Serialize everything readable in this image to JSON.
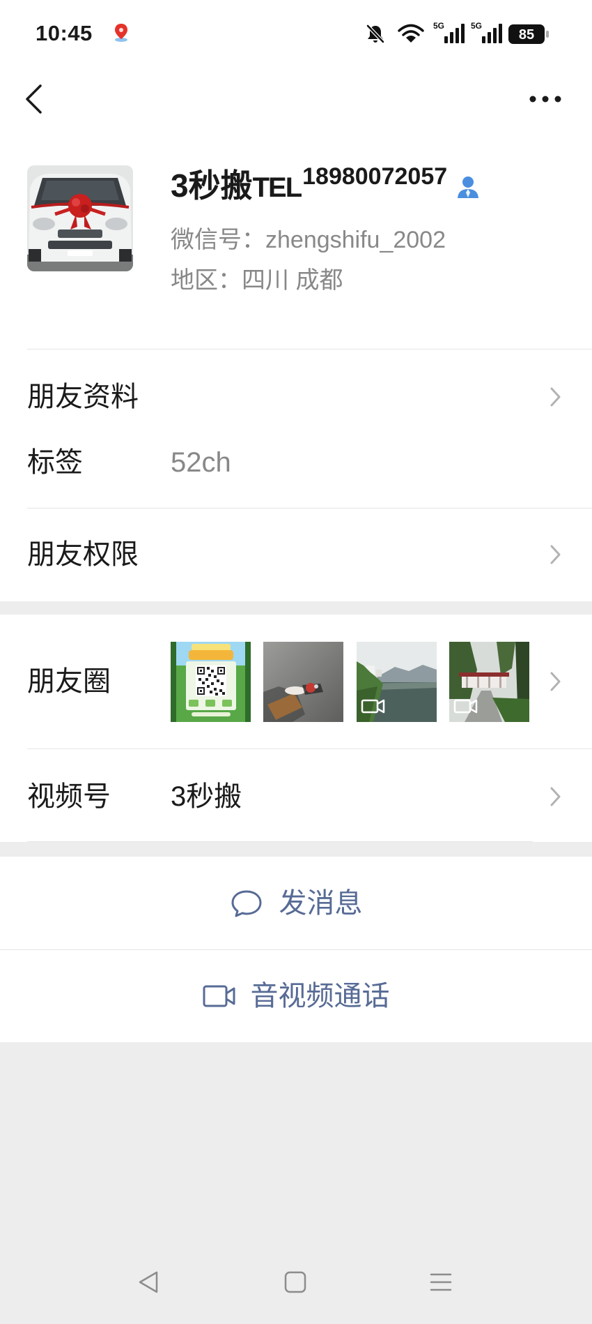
{
  "status_bar": {
    "time": "10:45",
    "network_1": "5G",
    "network_2": "5G",
    "battery": "85",
    "icons": [
      "location-pin-icon",
      "mute-bell-icon",
      "wifi-icon",
      "signal-icon",
      "signal-icon",
      "battery-icon"
    ]
  },
  "header": {
    "back_icon": "back-arrow-icon",
    "more_icon": "more-icon"
  },
  "profile": {
    "name": "3秒搬",
    "name_suffix": "TEL",
    "name_superscript": "18980072057",
    "wechat_id": "微信号：zhengshifu_2002",
    "region": "地区：四川 成都",
    "badge_icon": "contact-person-icon"
  },
  "rows": {
    "friend_profile": {
      "label": "朋友资料"
    },
    "tags": {
      "label": "标签",
      "value": "52ch"
    },
    "friend_permissions": {
      "label": "朋友权限"
    },
    "moments": {
      "label": "朋友圈",
      "thumbnails": [
        {
          "video": false
        },
        {
          "video": false
        },
        {
          "video": true
        },
        {
          "video": true
        }
      ]
    },
    "channels": {
      "label": "视频号",
      "value": "3秒搬"
    }
  },
  "actions": {
    "send_message": "发消息",
    "send_message_icon": "chat-bubble-icon",
    "av_call": "音视频通话",
    "av_call_icon": "video-camera-icon"
  },
  "nav_bar": {
    "icons": [
      "nav-back-icon",
      "nav-home-icon",
      "nav-recents-icon"
    ]
  },
  "theme": {
    "link_color": "#576b95",
    "primary_text": "#1a1a1a",
    "secondary_text": "#888888",
    "chevron": "#b2b2b2",
    "badge": "#4a8fdf",
    "background": "#ededed"
  }
}
